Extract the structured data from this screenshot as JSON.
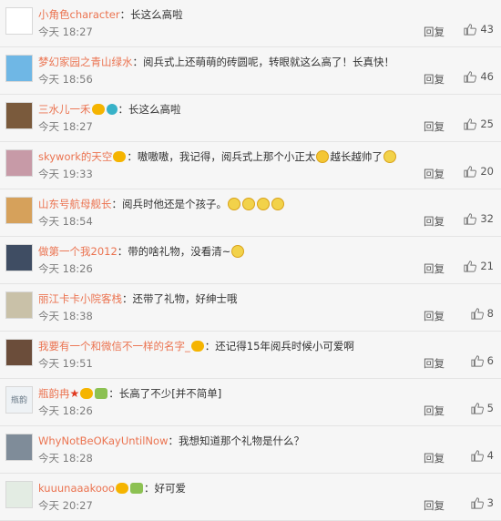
{
  "comments": [
    {
      "user": "小角色character",
      "badges": [],
      "text": "：长这么高啦",
      "time": "今天 18:27",
      "reply": "回复",
      "likes": "43",
      "avatar_color": "#ffffff"
    },
    {
      "user": "梦幻家园之青山绿水",
      "badges": [],
      "text": "：阅兵式上还萌萌的砖圆呢，转眼就这么高了！长真快！",
      "time": "今天 18:56",
      "reply": "回复",
      "likes": "46",
      "avatar_color": "#6fb7e5"
    },
    {
      "user": "三水儿一禾",
      "badges": [
        "vip",
        "circle"
      ],
      "text": "：长这么高啦",
      "time": "今天 18:27",
      "reply": "回复",
      "likes": "25",
      "avatar_color": "#7a5a3c"
    },
    {
      "user": "skywork的天空",
      "badges": [
        "vip"
      ],
      "text": "：嗷嗷嗷，我记得，阅兵式上那个小正太",
      "emoji_mid": 1,
      "text2": "越长越帅了",
      "emoji_end": 1,
      "time": "今天 19:33",
      "reply": "回复",
      "likes": "20",
      "avatar_color": "#c79aa7"
    },
    {
      "user": "山东号航母舰长",
      "badges": [],
      "text": "：阅兵时他还是个孩子。",
      "emoji_end": 4,
      "time": "今天 18:54",
      "reply": "回复",
      "likes": "32",
      "avatar_color": "#d6a15b"
    },
    {
      "user": "做第一个我2012",
      "badges": [],
      "text": "：带的啥礼物，没看清~",
      "emoji_end": 1,
      "time": "今天 18:26",
      "reply": "回复",
      "likes": "21",
      "avatar_color": "#3f4d63"
    },
    {
      "user": "丽江卡卡小院客栈",
      "badges": [],
      "text": "：还带了礼物，好绅士哦",
      "time": "今天 18:38",
      "reply": "回复",
      "likes": "8",
      "avatar_color": "#c9c1a8"
    },
    {
      "user": "我要有一个和微信不一样的名字_",
      "badges": [
        "vip"
      ],
      "text": "：还记得15年阅兵时候小可爱啊",
      "time": "今天 19:51",
      "reply": "回复",
      "likes": "6",
      "avatar_color": "#6b4d3a"
    },
    {
      "user": "瓶韵冉",
      "badges": [
        "star",
        "vip",
        "leaf"
      ],
      "text": "：长高了不少[并不简单]",
      "time": "今天 18:26",
      "reply": "回复",
      "likes": "5",
      "avatar_color": "#eef2f5",
      "avatar_text": "瓶韵"
    },
    {
      "user": "WhyNotBeOKayUntilNow",
      "badges": [],
      "text": "：我想知道那个礼物是什么？",
      "time": "今天 18:28",
      "reply": "回复",
      "likes": "4",
      "avatar_color": "#7f8c99"
    },
    {
      "user": "kuuunaaakooo",
      "badges": [
        "vip",
        "leaf"
      ],
      "text": "：好可爱",
      "time": "今天 20:27",
      "reply": "回复",
      "likes": "3",
      "avatar_color": "#e3ece3"
    }
  ]
}
